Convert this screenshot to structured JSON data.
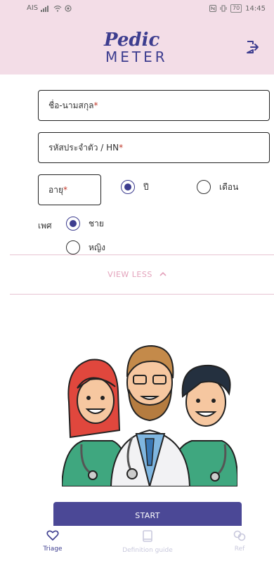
{
  "status_bar": {
    "carrier": "AIS",
    "battery": "70",
    "time": "14:45"
  },
  "header": {
    "logo_top": "Pedic",
    "logo_bottom": "METER",
    "logout_icon": "logout-icon"
  },
  "form": {
    "name_label": "ชื่อ-นามสกุล",
    "hn_label": "รหัสประจำตัว / HN",
    "age_label": "อายุ",
    "required_mark": "*",
    "age_unit_options": [
      {
        "label": "ปี",
        "checked": true
      },
      {
        "label": "เดือน",
        "checked": false
      }
    ],
    "gender_label": "เพศ",
    "gender_options": [
      {
        "label": "ชาย",
        "checked": true
      },
      {
        "label": "หญิง",
        "checked": false
      }
    ]
  },
  "view_less": {
    "label": "VIEW LESS",
    "icon": "chevron-up-icon"
  },
  "start_button": {
    "label": "START"
  },
  "tabbar": {
    "items": [
      {
        "label": "Triage",
        "icon": "heart-icon",
        "active": true
      },
      {
        "label": "Definition guide",
        "icon": "book-icon",
        "active": false
      },
      {
        "label": "Ref",
        "icon": "link-icon",
        "active": false
      }
    ]
  },
  "colors": {
    "header_bg": "#f3dde7",
    "brand": "#3d3d8f",
    "button_bg": "#4b4896",
    "accent_pink": "#e3a2bb"
  }
}
